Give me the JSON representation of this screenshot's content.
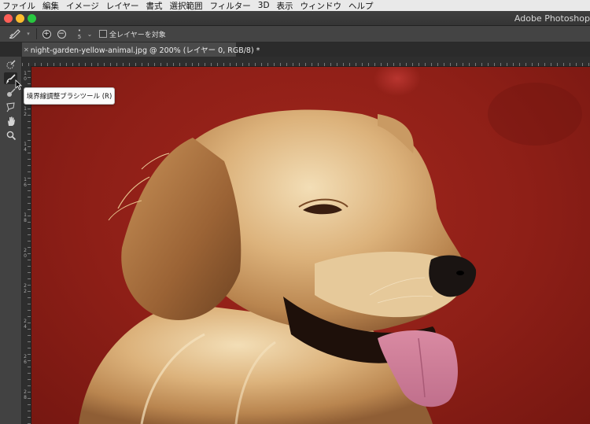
{
  "menubar": {
    "items": [
      "ファイル",
      "編集",
      "イメージ",
      "レイヤー",
      "書式",
      "選択範囲",
      "フィルター",
      "3D",
      "表示",
      "ウィンドウ",
      "ヘルプ"
    ]
  },
  "window": {
    "title": "Adobe Photoshop"
  },
  "options_bar": {
    "brush_size": "5",
    "sample_all_layers_label": "全レイヤーを対象",
    "sample_all_layers_checked": false,
    "icons": [
      "refine-edge-brush-icon",
      "chevron-down-icon",
      "add-to-selection-icon",
      "subtract-from-selection-icon",
      "chevron-down-icon"
    ]
  },
  "document": {
    "tab_title": "night-garden-yellow-animal.jpg @ 200% (レイヤー 0, RGB/8) *",
    "close_symbol": "✕"
  },
  "toolbar": {
    "tools": [
      "quick-selection-icon",
      "refine-edge-brush-icon",
      "brush-icon",
      "lasso-icon",
      "hand-icon",
      "zoom-icon"
    ],
    "active_tool": "refine-edge-brush-icon"
  },
  "tooltip": {
    "text": "境界線調整ブラシツール (R)"
  },
  "rulers": {
    "left_labels": [
      "1\n0",
      "1\n2",
      "1\n4",
      "1\n6",
      "1\n8",
      "2\n0",
      "2\n2",
      "2\n4",
      "2\n6",
      "2\n8"
    ]
  },
  "colors": {
    "canvas_background": "#8e1f17",
    "ui_dark": "#424242",
    "tooltip_bg": "#fbfbfb"
  }
}
